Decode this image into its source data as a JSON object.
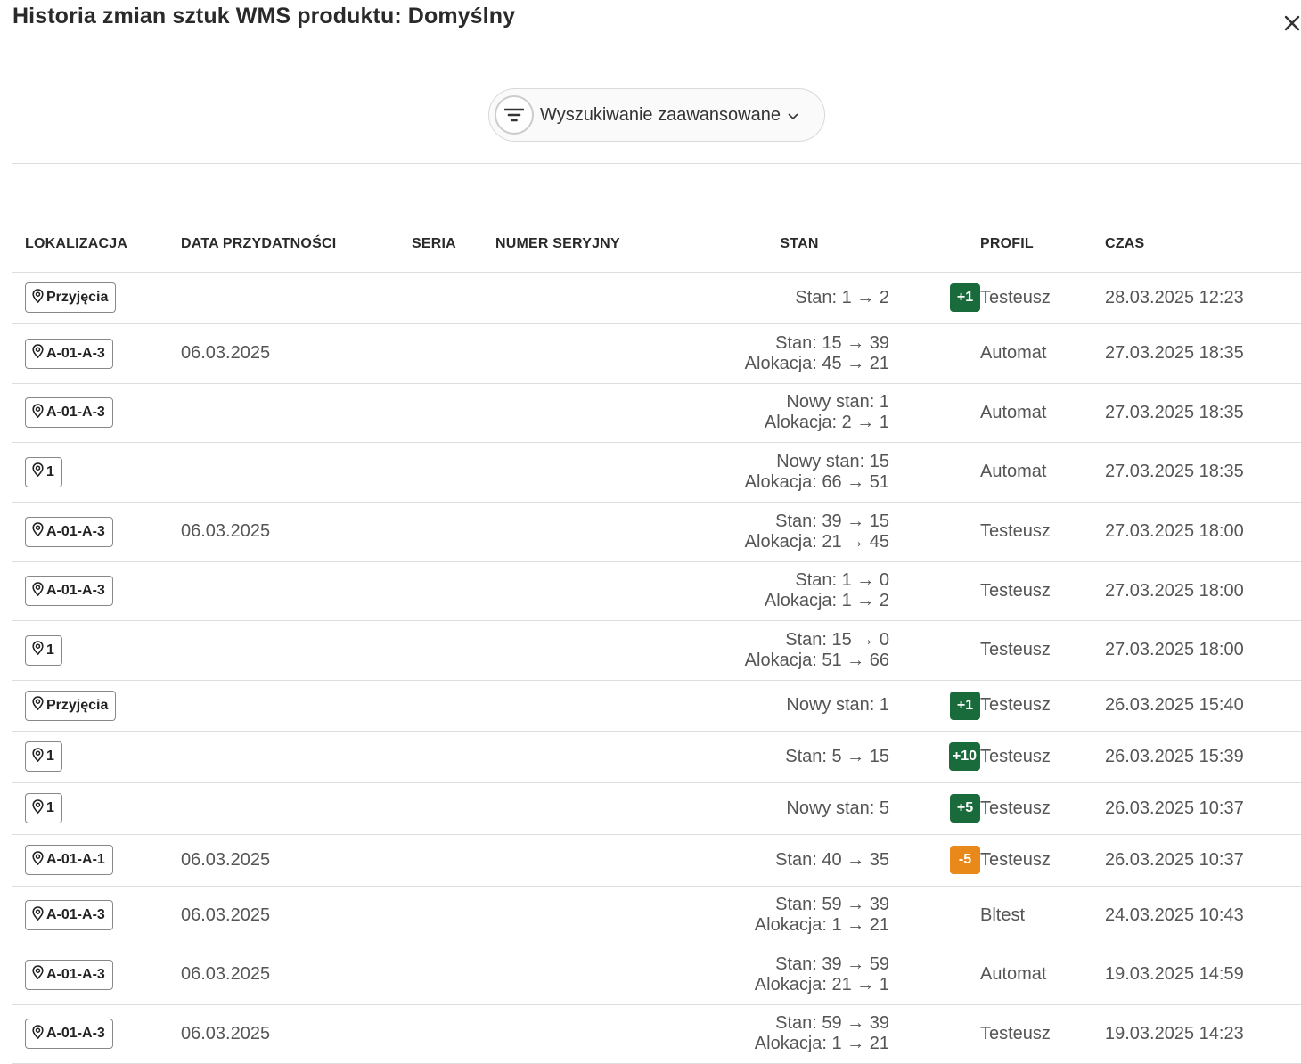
{
  "title": "Historia zmian sztuk WMS produktu: Domyślny",
  "search": {
    "label": "Wyszukiwanie zaawansowane"
  },
  "colors": {
    "positive": "#1a6b3c",
    "negative": "#e8891a"
  },
  "columns": [
    "LOKALIZACJA",
    "DATA PRZYDATNOŚCI",
    "SERIA",
    "NUMER SERYJNY",
    "STAN",
    "PROFIL",
    "CZAS"
  ],
  "rows": [
    {
      "location": "Przyjęcia",
      "expiry": "",
      "series": "",
      "serial": "",
      "lines": [
        "Stan: 1 → 2"
      ],
      "delta": "+1",
      "delta_type": "positive",
      "profile": "Testeusz",
      "time": "28.03.2025 12:23"
    },
    {
      "location": "A-01-A-3",
      "expiry": "06.03.2025",
      "series": "",
      "serial": "",
      "lines": [
        "Stan: 15 → 39",
        "Alokacja: 45 → 21"
      ],
      "delta": "",
      "delta_type": "",
      "profile": "Automat",
      "time": "27.03.2025 18:35"
    },
    {
      "location": "A-01-A-3",
      "expiry": "",
      "series": "",
      "serial": "",
      "lines": [
        "Nowy stan: 1",
        "Alokacja: 2 → 1"
      ],
      "delta": "",
      "delta_type": "",
      "profile": "Automat",
      "time": "27.03.2025 18:35"
    },
    {
      "location": "1",
      "expiry": "",
      "series": "",
      "serial": "",
      "lines": [
        "Nowy stan: 15",
        "Alokacja: 66 → 51"
      ],
      "delta": "",
      "delta_type": "",
      "profile": "Automat",
      "time": "27.03.2025 18:35"
    },
    {
      "location": "A-01-A-3",
      "expiry": "06.03.2025",
      "series": "",
      "serial": "",
      "lines": [
        "Stan: 39 → 15",
        "Alokacja: 21 → 45"
      ],
      "delta": "",
      "delta_type": "",
      "profile": "Testeusz",
      "time": "27.03.2025 18:00"
    },
    {
      "location": "A-01-A-3",
      "expiry": "",
      "series": "",
      "serial": "",
      "lines": [
        "Stan: 1 → 0",
        "Alokacja: 1 → 2"
      ],
      "delta": "",
      "delta_type": "",
      "profile": "Testeusz",
      "time": "27.03.2025 18:00"
    },
    {
      "location": "1",
      "expiry": "",
      "series": "",
      "serial": "",
      "lines": [
        "Stan: 15 → 0",
        "Alokacja: 51 → 66"
      ],
      "delta": "",
      "delta_type": "",
      "profile": "Testeusz",
      "time": "27.03.2025 18:00"
    },
    {
      "location": "Przyjęcia",
      "expiry": "",
      "series": "",
      "serial": "",
      "lines": [
        "Nowy stan: 1"
      ],
      "delta": "+1",
      "delta_type": "positive",
      "profile": "Testeusz",
      "time": "26.03.2025 15:40"
    },
    {
      "location": "1",
      "expiry": "",
      "series": "",
      "serial": "",
      "lines": [
        "Stan: 5 → 15"
      ],
      "delta": "+10",
      "delta_type": "positive",
      "profile": "Testeusz",
      "time": "26.03.2025 15:39"
    },
    {
      "location": "1",
      "expiry": "",
      "series": "",
      "serial": "",
      "lines": [
        "Nowy stan: 5"
      ],
      "delta": "+5",
      "delta_type": "positive",
      "profile": "Testeusz",
      "time": "26.03.2025 10:37"
    },
    {
      "location": "A-01-A-1",
      "expiry": "06.03.2025",
      "series": "",
      "serial": "",
      "lines": [
        "Stan: 40 → 35"
      ],
      "delta": "-5",
      "delta_type": "negative",
      "profile": "Testeusz",
      "time": "26.03.2025 10:37"
    },
    {
      "location": "A-01-A-3",
      "expiry": "06.03.2025",
      "series": "",
      "serial": "",
      "lines": [
        "Stan: 59 → 39",
        "Alokacja: 1 → 21"
      ],
      "delta": "",
      "delta_type": "",
      "profile": "Bltest",
      "time": "24.03.2025 10:43"
    },
    {
      "location": "A-01-A-3",
      "expiry": "06.03.2025",
      "series": "",
      "serial": "",
      "lines": [
        "Stan: 39 → 59",
        "Alokacja: 21 → 1"
      ],
      "delta": "",
      "delta_type": "",
      "profile": "Automat",
      "time": "19.03.2025 14:59"
    },
    {
      "location": "A-01-A-3",
      "expiry": "06.03.2025",
      "series": "",
      "serial": "",
      "lines": [
        "Stan: 59 → 39",
        "Alokacja: 1 → 21"
      ],
      "delta": "",
      "delta_type": "",
      "profile": "Testeusz",
      "time": "19.03.2025 14:23"
    }
  ]
}
